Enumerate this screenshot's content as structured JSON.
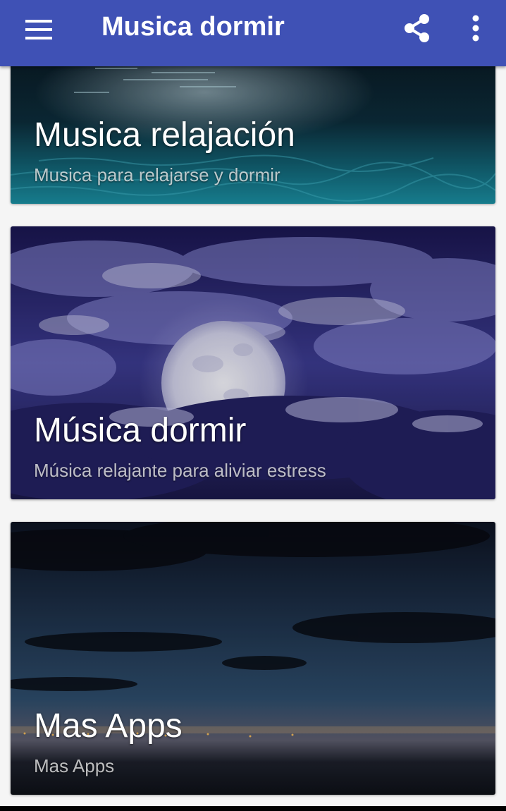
{
  "app_bar": {
    "title": "Musica dormir",
    "background_color": "#3f51b5",
    "menu_icon": "hamburger-menu-icon",
    "share_icon": "share-icon",
    "more_icon": "more-vert-icon"
  },
  "cards": [
    {
      "title": "Musica relajación",
      "subtitle": "Musica para relajarse y dormir",
      "image": "night-sea-reflection"
    },
    {
      "title": "Música dormir",
      "subtitle": "Música relajante para aliviar estress",
      "image": "full-moon-clouds"
    },
    {
      "title": "Mas Apps",
      "subtitle": "Mas Apps",
      "image": "dusk-sky-coast"
    }
  ]
}
